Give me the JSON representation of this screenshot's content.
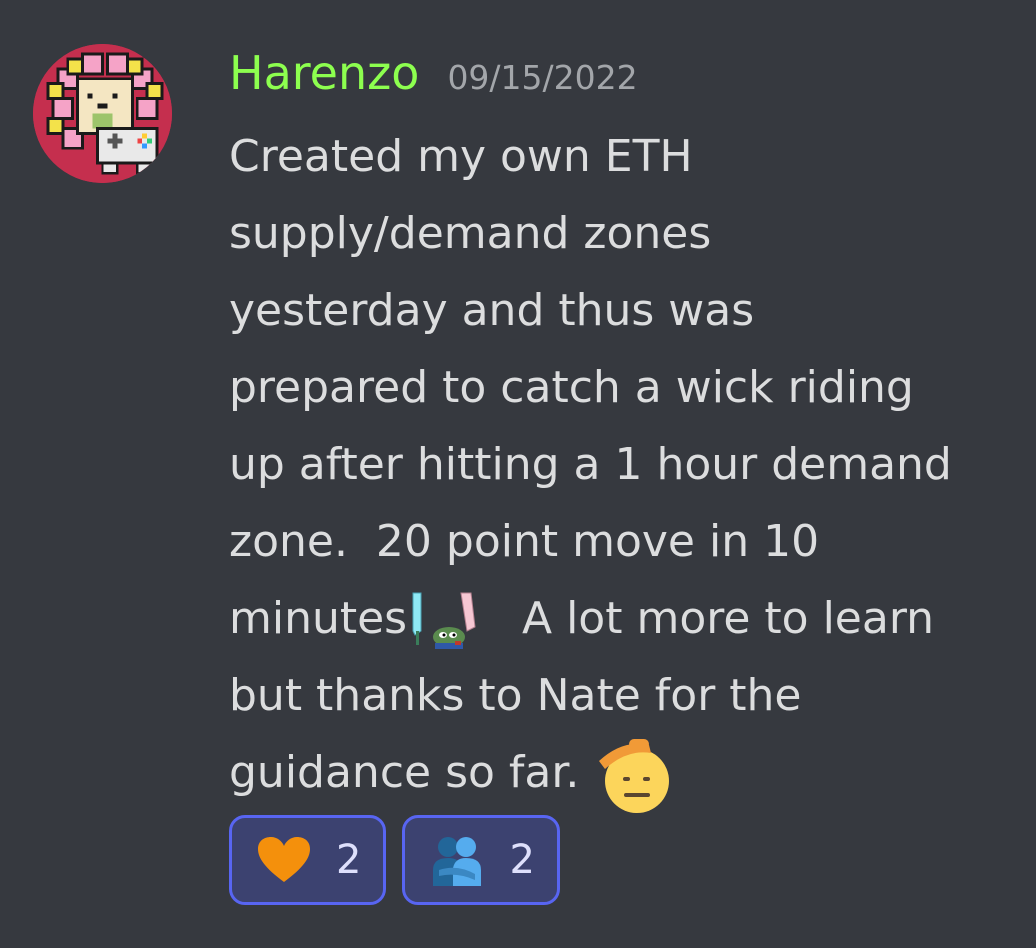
{
  "message": {
    "author": {
      "name": "Harenzo",
      "name_color": "#8dff4f",
      "avatar_icon": "pixel-flower-gamepad-avatar"
    },
    "timestamp": "09/15/2022",
    "content_lines": [
      "Created my own ETH",
      "supply/demand zones",
      "yesterday and thus was",
      "prepared to catch a wick riding",
      "up after hitting a 1 hour demand",
      "zone.  20 point move in 10",
      "minutes",
      " A lot more to learn",
      "but thanks to Nate for the",
      "guidance so far. "
    ],
    "inline_emojis": [
      {
        "name": "pepe-sword-emoji",
        "after_line": 7
      },
      {
        "name": "saluting-face-emoji",
        "after_line": 10
      }
    ],
    "reactions": [
      {
        "emoji": "orange-heart-emoji",
        "count": "2"
      },
      {
        "emoji": "people-hugging-emoji",
        "count": "2"
      }
    ]
  },
  "colors": {
    "background": "#36393f",
    "text": "#dcddde",
    "timestamp": "#a3a6aa",
    "reaction_border": "#5865f2",
    "reaction_bg": "#3c4270"
  }
}
